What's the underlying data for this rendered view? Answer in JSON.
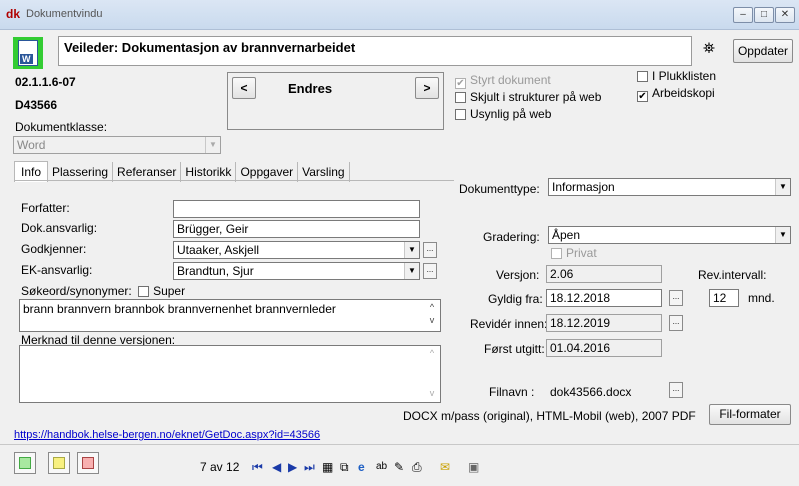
{
  "window": {
    "title": "Dokumentvindu",
    "minimize": "–",
    "maximize": "□",
    "close": "✕"
  },
  "header": {
    "doc_title": "Veileder: Dokumentasjon av brannvernarbeidet",
    "update_button": "Oppdater",
    "word_badge": "W"
  },
  "doc": {
    "number": "02.1.1.6-07",
    "id": "D43566",
    "class_label": "Dokumentklasse:",
    "class_value": "Word"
  },
  "nav": {
    "prev": "<",
    "next": ">",
    "status": "Endres"
  },
  "flags": {
    "styrt": {
      "label": "Styrt dokument",
      "checked": true,
      "disabled": true
    },
    "skjult": {
      "label": "Skjult i strukturer på web",
      "checked": false
    },
    "usynlig": {
      "label": "Usynlig på web",
      "checked": false
    },
    "plukk": {
      "label": "I Plukklisten",
      "checked": false
    },
    "arbeid": {
      "label": "Arbeidskopi",
      "checked": true
    }
  },
  "tabs": [
    "Info",
    "Plassering",
    "Referanser",
    "Historikk",
    "Oppgaver",
    "Varsling"
  ],
  "info": {
    "forfatter_label": "Forfatter:",
    "forfatter_value": "",
    "dokansvarlig_label": "Dok.ansvarlig:",
    "dokansvarlig_value": "Brügger, Geir",
    "godkjenner_label": "Godkjenner:",
    "godkjenner_value": "Utaaker, Askjell",
    "ekansvarlig_label": "EK-ansvarlig:",
    "ekansvarlig_value": "Brandtun, Sjur",
    "sokeord_label": "Søkeord/synonymer:",
    "super_label": "Super",
    "sokeord_value": "brann brannvern brannbok brannvernenhet brannvernleder",
    "merknad_label": "Merknad til denne versjonen:",
    "merknad_value": ""
  },
  "right": {
    "dokumenttype_label": "Dokumenttype:",
    "dokumenttype_value": "Informasjon",
    "gradering_label": "Gradering:",
    "gradering_value": "Åpen",
    "privat_label": "Privat",
    "versjon_label": "Versjon:",
    "versjon_value": "2.06",
    "revintervall_label": "Rev.intervall:",
    "revintervall_value": "12",
    "revintervall_unit": "mnd.",
    "gyldig_label": "Gyldig fra:",
    "gyldig_value": "18.12.2018",
    "revider_label": "Revidér innen:",
    "revider_value": "18.12.2019",
    "forst_label": "Først utgitt:",
    "forst_value": "01.04.2016",
    "filnavn_label": "Filnavn :",
    "filnavn_value": "dok43566.docx",
    "formats_text": "DOCX m/pass (original), HTML-Mobil (web), 2007 PDF",
    "formats_button": "Fil-formater"
  },
  "link": {
    "url": "https://handbok.helse-bergen.no/eknet/GetDoc.aspx?id=43566"
  },
  "footer": {
    "counter": "7 av 12"
  },
  "colors": {
    "accent_green": "#33cc33",
    "link": "#0000cc",
    "titlebar": "#c9daee"
  }
}
